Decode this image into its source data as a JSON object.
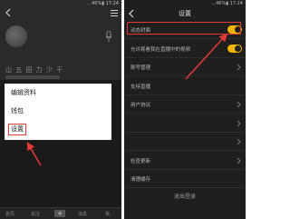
{
  "left": {
    "status": "…46%▮ 17:24",
    "profile_name": "山 五 田 力 少 干",
    "menu": {
      "items": [
        "编辑资料",
        "钱包",
        "设置"
      ],
      "selected_index": 2
    },
    "nav": [
      "首页",
      "关注",
      "+",
      "消息",
      "我"
    ]
  },
  "right": {
    "status": "…46%▮ 17:24",
    "title": "设置",
    "rows": [
      {
        "label": "动态封面",
        "control": "toggle",
        "on": true
      },
      {
        "label": "允许观看我在直播中的视频",
        "control": "toggle",
        "on": true
      },
      {
        "label": "账号管理",
        "control": "chevron"
      },
      {
        "label": "支持直播",
        "control": "none"
      },
      {
        "label": "用户协议",
        "control": "chevron"
      },
      {
        "label": "",
        "control": "chevron"
      },
      {
        "label": "",
        "control": "chevron"
      },
      {
        "label": "检查更新",
        "control": "chevron"
      },
      {
        "label": "清理缓存",
        "control": "none"
      }
    ],
    "logout": "退出登录"
  },
  "colors": {
    "accent": "#f5b400",
    "annotation": "#e53935"
  }
}
